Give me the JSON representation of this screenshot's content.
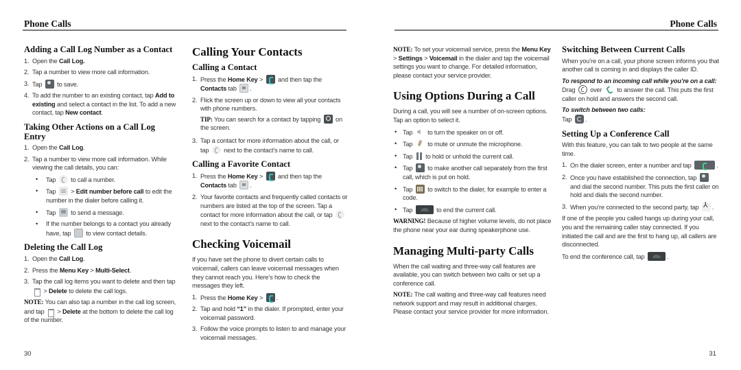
{
  "header": {
    "left_title": "Phone Calls",
    "right_title": "Phone Calls"
  },
  "page_numbers": {
    "left": "30",
    "right": "31"
  },
  "col1": {
    "add_log": {
      "title": "Adding a Call Log Number as a Contact",
      "steps": [
        {
          "n": "1.",
          "pre": "Open the ",
          "b1": "Call Log."
        },
        {
          "n": "2.",
          "text": "Tap a number to view more call information."
        },
        {
          "n": "3.",
          "pre": "Tap ",
          "icon": "add-contact-icon",
          "post": " to save."
        },
        {
          "n": "4.",
          "pre": "To add the number to an existing contact, tap ",
          "b1": "Add to existing",
          "mid": " and select a contact in the list. To add a new contact, tap ",
          "b2": "New contact",
          "post": "."
        }
      ]
    },
    "other_actions": {
      "title": "Taking Other Actions on a Call Log Entry",
      "step1": {
        "n": "1.",
        "pre": "Open the ",
        "b1": "Call Log",
        "post": "."
      },
      "step2": {
        "n": "2.",
        "text": "Tap a number to view more call information. While viewing the call details, you can:"
      },
      "bullets": [
        {
          "pre": "Tap ",
          "icon": "call-icon",
          "post": " to call a number."
        },
        {
          "pre": "Tap ",
          "icon": "menu-icon",
          "mid": " > ",
          "b1": "Edit number before call",
          "post": " to edit the number in the dialer before calling it."
        },
        {
          "pre": "Tap ",
          "icon": "message-icon",
          "post": " to send a message."
        },
        {
          "pre": "If the number belongs to a contact you already have, tap ",
          "icon": "contact-details-icon",
          "post": " to view contact details."
        }
      ]
    },
    "delete_log": {
      "title": "Deleting the Call Log",
      "steps": [
        {
          "n": "1.",
          "pre": "Open the ",
          "b1": "Call Log",
          "post": "."
        },
        {
          "n": "2.",
          "pre": "Press the ",
          "b1": "Menu Key",
          "mid": " > ",
          "b2": "Multi-Select",
          "post": "."
        },
        {
          "n": "3.",
          "pre": "Tap the call log items you want to delete and then tap ",
          "icon": "trash-icon",
          "mid": " > ",
          "b1": "Delete",
          "post": " to delete the call logs."
        }
      ],
      "note_label": "NOTE:",
      "note_pre": " You can also tap a number in the call log screen, and tap ",
      "note_mid": " > ",
      "note_bold": "Delete",
      "note_post": " at the bottom to delete the call log of the number."
    }
  },
  "col2": {
    "title": "Calling Your Contacts",
    "calling_contact": {
      "title": "Calling a Contact",
      "step1": {
        "n": "1.",
        "pre": "Press the ",
        "b1": "Home Key",
        "mid": " > ",
        "mid2": " and then tap the ",
        "b2": "Contacts",
        "post": " tab ",
        "end": "."
      },
      "step2": {
        "n": "2.",
        "text": "Flick the screen up or down to view all your contacts with phone numbers."
      },
      "tip_label": "TIP:",
      "tip_pre": " You can search for a contact by tapping ",
      "tip_post": " on the screen.",
      "step3": {
        "n": "3.",
        "pre": "Tap a contact for more information about the call, or tap ",
        "post": " next to the contact’s name to call."
      }
    },
    "calling_favorite": {
      "title": "Calling a Favorite Contact",
      "step1": {
        "n": "1.",
        "pre": "Press the ",
        "b1": "Home Key",
        "mid": " > ",
        "mid2": " and then tap the ",
        "b2": "Contacts",
        "post": " tab ",
        "end": "."
      },
      "step2": {
        "n": "2.",
        "pre": "Your favorite contacts and frequently called contacts or numbers are listed at the top of the screen. Tap a contact for more information about the call, or tap ",
        "post": " next to the contact’s name to call."
      }
    },
    "voicemail": {
      "title": "Checking Voicemail",
      "intro": "If you have set the phone to divert certain calls to voicemail, callers can leave voicemail messages when they cannot reach you. Here’s how to check the messages they left.",
      "step1": {
        "n": "1.",
        "pre": "Press the ",
        "b1": "Home Key",
        "mid": " > ",
        "end": "."
      },
      "step2": {
        "n": "2.",
        "pre": "Tap and hold ",
        "b1": "“1”",
        "post": " in the dialer. If prompted, enter your voicemail password."
      },
      "step3": {
        "n": "3.",
        "text": "Follow the voice prompts to listen to and manage your voicemail messages."
      }
    }
  },
  "col3": {
    "note": {
      "label": "NOTE:",
      "pre": " To set your voicemail service, press the ",
      "b1": "Menu Key",
      "m1": " > ",
      "b2": "Settings",
      "m2": " > ",
      "b3": "Voicemail",
      "post": " in the dialer and tap the voicemail settings you want to change. For detailed information, please contact your service provider."
    },
    "options": {
      "title": "Using Options During a Call",
      "intro": "During a call, you will see a number of on-screen options. Tap an option to select it.",
      "bullets": [
        {
          "pre": "Tap ",
          "icon": "speaker-icon",
          "post": " to turn the speaker on or off."
        },
        {
          "pre": "Tap ",
          "icon": "mute-icon",
          "post": " to mute or unmute the microphone."
        },
        {
          "pre": "Tap ",
          "icon": "hold-icon",
          "post": " to hold or unhold the current call."
        },
        {
          "pre": "Tap ",
          "icon": "add-call-icon",
          "post": " to make another call separately from the first call, which is put on hold."
        },
        {
          "pre": "Tap ",
          "icon": "dialpad-icon",
          "post": " to switch to the dialer, for example to enter a code."
        },
        {
          "pre": "Tap ",
          "icon": "end-call-icon",
          "post": " to end the current call."
        }
      ],
      "warning_label": "WARNING!",
      "warning_text": " Because of higher volume levels, do not place the phone near your ear during speakerphone use."
    },
    "multiparty": {
      "title": "Managing Multi-party Calls",
      "intro": "When the call waiting and three-way call features are available, you can switch between two calls or set up a conference call.",
      "note_label": "NOTE:",
      "note_text": " The call waiting and three-way call features need network support and may result in additional charges. Please contact your service provider for more information."
    }
  },
  "col4": {
    "switching": {
      "title": "Switching Between Current Calls",
      "intro": "When you’re on a call, your phone screen informs you that another call is coming in and displays the caller ID.",
      "sub1": "To respond to an incoming call while you’re on a call:",
      "drag_pre": "Drag ",
      "drag_mid": " over ",
      "drag_post": " to answer the call. This puts the first caller on hold and answers the second call.",
      "sub2": "To switch between two calls:",
      "tap_pre": "Tap ",
      "tap_post": "."
    },
    "conference": {
      "title": "Setting Up a Conference Call",
      "intro": "With this feature, you can talk to two people at the same time.",
      "steps": [
        {
          "n": "1.",
          "pre": "On the dialer screen, enter a number and tap ",
          "post": "."
        },
        {
          "n": "2.",
          "pre": "Once you have established the connection, tap ",
          "post": " and dial the second number. This puts the first caller on hold and dials the second number."
        },
        {
          "n": "3.",
          "pre": "When you’re connected to the second party, tap ",
          "post": "."
        }
      ],
      "hangup_text": "If one of the people you called hangs up during your call, you and the remaining caller stay connected. If you initiated the call and are the first to hang up, all callers are disconnected.",
      "end_pre": "To end the conference call, tap ",
      "end_post": "."
    }
  }
}
